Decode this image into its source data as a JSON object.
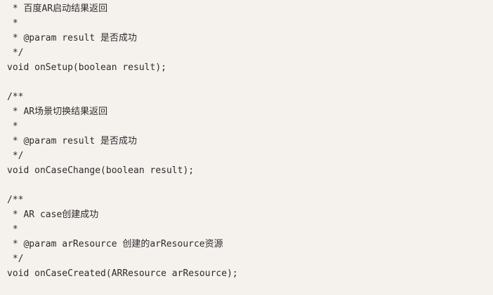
{
  "code_lines": [
    " * 百度AR启动结果返回",
    " *",
    " * @param result 是否成功",
    " */",
    "void onSetup(boolean result);",
    "",
    "/**",
    " * AR场景切换结果返回",
    " *",
    " * @param result 是否成功",
    " */",
    "void onCaseChange(boolean result);",
    "",
    "/**",
    " * AR case创建成功",
    " *",
    " * @param arResource 创建的arResource资源",
    " */",
    "void onCaseCreated(ARResource arResource);"
  ]
}
